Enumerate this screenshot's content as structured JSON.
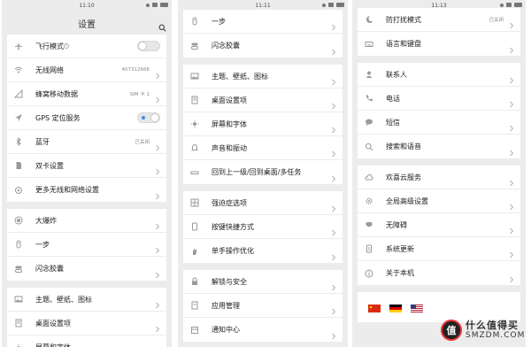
{
  "screens": [
    {
      "time": "11:10",
      "title": "设置",
      "groups": [
        [
          {
            "label": "飞行模式",
            "icon": "airplane-icon",
            "control": "toggle-off",
            "info": "i"
          },
          {
            "label": "无线网络",
            "icon": "wifi-icon",
            "value": "407312666"
          },
          {
            "label": "蜂窝移动数据",
            "icon": "signal-icon",
            "value": "SIM 卡 1"
          },
          {
            "label": "GPS 定位服务",
            "icon": "location-icon",
            "control": "toggle-on"
          },
          {
            "label": "蓝牙",
            "icon": "bluetooth-icon",
            "value": "已关闭"
          },
          {
            "label": "双卡设置",
            "icon": "sim-card-icon"
          },
          {
            "label": "更多无线和网络设置",
            "icon": "network-settings-icon"
          }
        ],
        [
          {
            "label": "大爆炸",
            "icon": "big-bang-icon"
          },
          {
            "label": "一步",
            "icon": "one-step-icon"
          },
          {
            "label": "闪念胶囊",
            "icon": "capsule-icon"
          }
        ],
        [
          {
            "label": "主题、壁纸、图标",
            "icon": "theme-icon"
          },
          {
            "label": "桌面设置项",
            "icon": "desktop-icon"
          },
          {
            "label": "屏幕和字体",
            "icon": "display-icon"
          }
        ]
      ]
    },
    {
      "time": "11:11",
      "title": "设置",
      "groups": [
        [
          {
            "label": "一步",
            "icon": "one-step-icon"
          },
          {
            "label": "闪念胶囊",
            "icon": "capsule-icon"
          }
        ],
        [
          {
            "label": "主题、壁纸、图标",
            "icon": "theme-icon"
          },
          {
            "label": "桌面设置项",
            "icon": "desktop-icon"
          },
          {
            "label": "屏幕和字体",
            "icon": "display-icon"
          },
          {
            "label": "声音和振动",
            "icon": "bell-icon"
          },
          {
            "label": "回到上一级/回到桌面/多任务",
            "icon": "home-bar-icon"
          }
        ],
        [
          {
            "label": "强迫症选项",
            "icon": "grid-icon"
          },
          {
            "label": "按键快捷方式",
            "icon": "phone-button-icon"
          },
          {
            "label": "单手操作优化",
            "icon": "hand-icon"
          }
        ],
        [
          {
            "label": "解锁与安全",
            "icon": "lock-icon"
          },
          {
            "label": "应用管理",
            "icon": "apps-icon"
          },
          {
            "label": "通知中心",
            "icon": "notification-icon"
          }
        ]
      ]
    },
    {
      "time": "11:13",
      "title": "设置",
      "groups": [
        [
          {
            "label": "防打扰模式",
            "icon": "moon-icon",
            "value": "已关闭"
          },
          {
            "label": "语言和键盘",
            "icon": "keyboard-icon"
          }
        ],
        [
          {
            "label": "联系人",
            "icon": "contacts-icon"
          },
          {
            "label": "电话",
            "icon": "phone-icon"
          },
          {
            "label": "短信",
            "icon": "message-icon"
          },
          {
            "label": "搜索和语音",
            "icon": "search-voice-icon"
          }
        ],
        [
          {
            "label": "欢喜云服务",
            "icon": "cloud-icon"
          },
          {
            "label": "全局高级设置",
            "icon": "gear-icon"
          },
          {
            "label": "无障碍",
            "icon": "accessibility-icon"
          },
          {
            "label": "系统更新",
            "icon": "update-icon"
          },
          {
            "label": "关于本机",
            "icon": "about-icon"
          }
        ]
      ],
      "flags": [
        "china-flag-icon",
        "germany-flag-icon",
        "usa-flag-icon"
      ]
    }
  ],
  "watermark": {
    "cn": "什么值得买",
    "en": "SMZDM.COM",
    "logo": "值"
  },
  "colors": {
    "background": "#ececec",
    "card": "#ffffff",
    "accent": "#3e8ee9",
    "icon": "#9a9a9a"
  }
}
